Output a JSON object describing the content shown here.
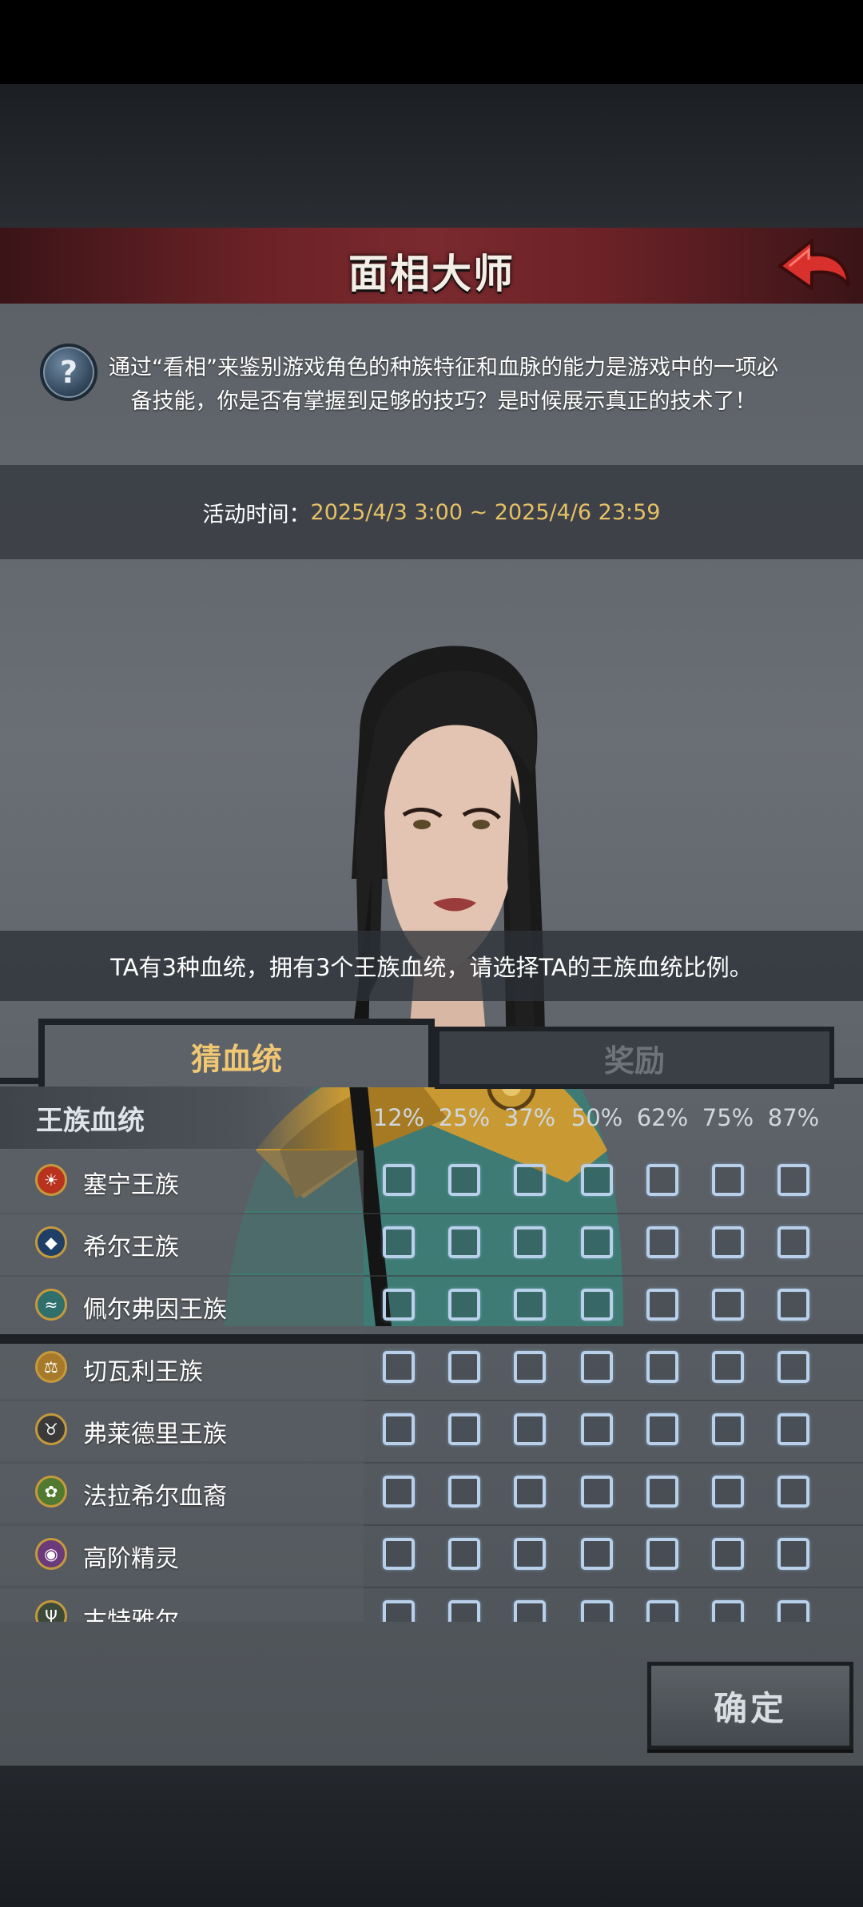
{
  "header": {
    "title": "面相大师"
  },
  "intro": {
    "text": "通过“看相”来鉴别游戏角色的种族特征和血脉的能力是游戏中的一项必备技能，你是否有掌握到足够的技巧？是时候展示真正的技术了！",
    "help_symbol": "?"
  },
  "event_time": {
    "label": "活动时间：",
    "value": "2025/4/3 3:00 ~ 2025/4/6 23:59"
  },
  "question": "TA有3种血统，拥有3个王族血统，请选择TA的王族血统比例。",
  "tabs": [
    {
      "label": "猜血统",
      "active": true
    },
    {
      "label": "奖励",
      "active": false
    }
  ],
  "table": {
    "header_title": "王族血统",
    "percentages": [
      "12%",
      "25%",
      "37%",
      "50%",
      "62%",
      "75%",
      "87%"
    ],
    "rows": [
      {
        "label": "塞宁王族",
        "icon": "sun-emblem-icon",
        "color": "#b8321e"
      },
      {
        "label": "希尔王族",
        "icon": "mask-emblem-icon",
        "color": "#1f3f66"
      },
      {
        "label": "佩尔弗因王族",
        "icon": "wave-emblem-icon",
        "color": "#2f6f6c"
      },
      {
        "label": "切瓦利王族",
        "icon": "scales-emblem-icon",
        "color": "#a67a2a"
      },
      {
        "label": "弗莱德里王族",
        "icon": "bull-emblem-icon",
        "color": "#3a3a3a"
      },
      {
        "label": "法拉希尔血裔",
        "icon": "tree-emblem-icon",
        "color": "#4f7a2f"
      },
      {
        "label": "高阶精灵",
        "icon": "eye-emblem-icon",
        "color": "#6b3a7a"
      },
      {
        "label": "古特雅尔",
        "icon": "trident-emblem-icon",
        "color": "#3d4a3a"
      }
    ]
  },
  "confirm_label": "确定",
  "colors": {
    "accent_gold": "#e7c166",
    "banner_red": "#7a2a2e",
    "checkbox": "#b8d0ea"
  }
}
